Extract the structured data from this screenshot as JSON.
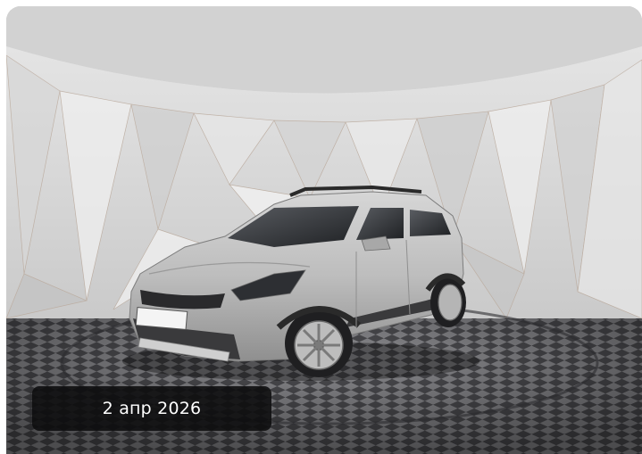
{
  "listing": {
    "date": "2 апр 2026"
  },
  "colors": {
    "badge_background": "#0c0c0e",
    "badge_text": "#ffffff",
    "car_body": "#bfbfbf",
    "studio_wall": "#dedede",
    "floor_dark": "#5a5a5e"
  }
}
